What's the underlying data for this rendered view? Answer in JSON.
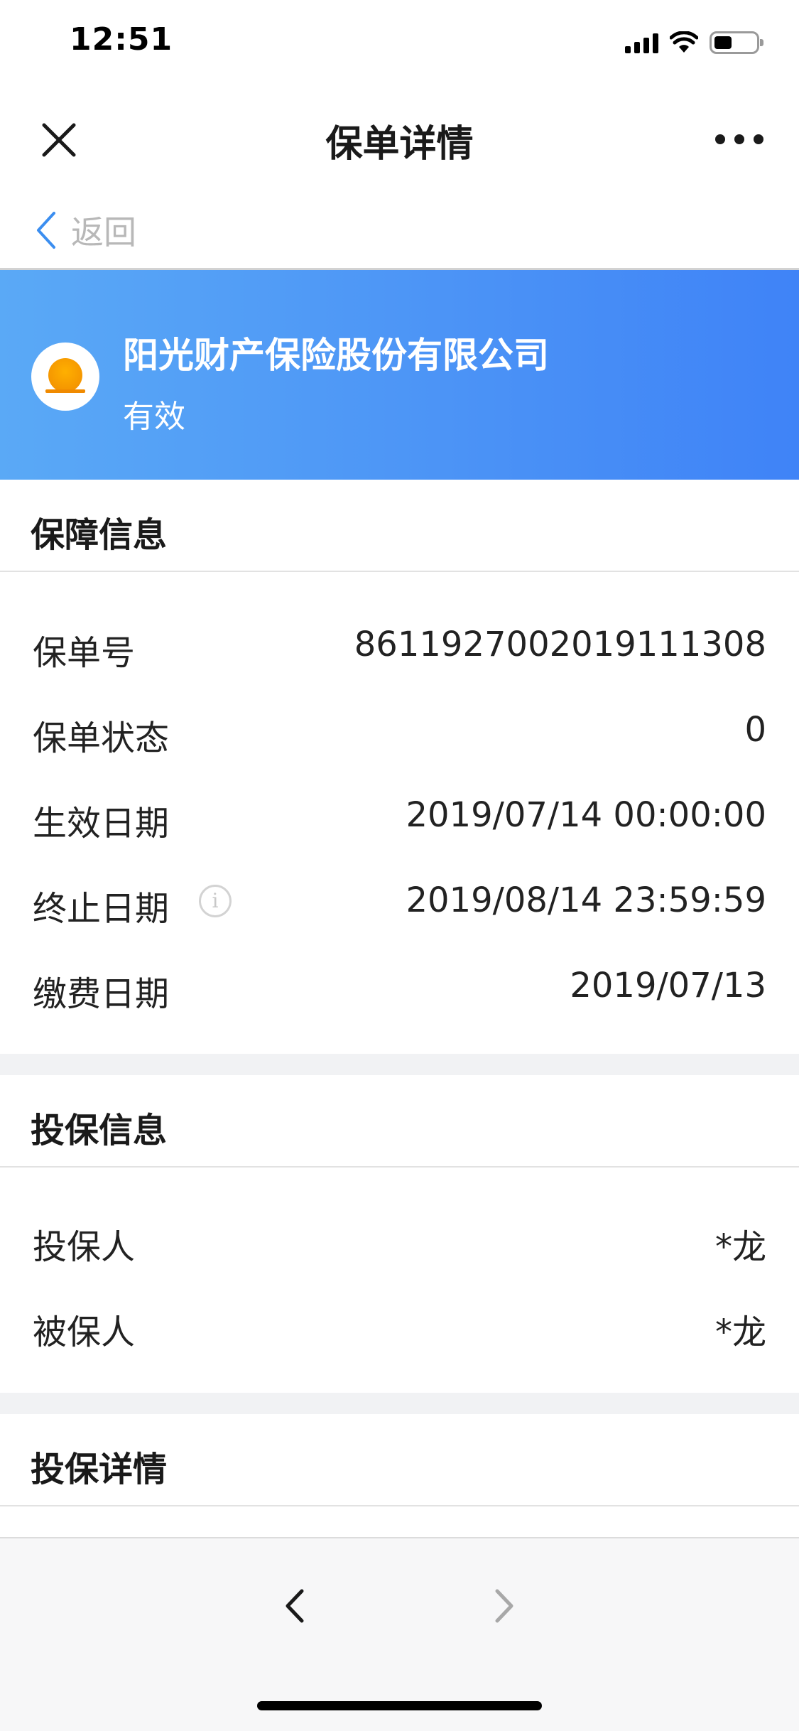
{
  "status_bar": {
    "time": "12:51"
  },
  "nav": {
    "title": "保单详情"
  },
  "back": {
    "label": "返回"
  },
  "banner": {
    "company": "阳光财产保险股份有限公司",
    "status": "有效"
  },
  "sections": {
    "coverage": {
      "title": "保障信息",
      "rows": [
        {
          "label": "保单号",
          "value": "8611927002019111308"
        },
        {
          "label": "保单状态",
          "value": "0"
        },
        {
          "label": "生效日期",
          "value": "2019/07/14 00:00:00"
        },
        {
          "label": "终止日期",
          "value": "2019/08/14 23:59:59"
        },
        {
          "label": "缴费日期",
          "value": "2019/07/13"
        }
      ]
    },
    "insure": {
      "title": "投保信息",
      "rows": [
        {
          "label": "投保人",
          "value": "*龙"
        },
        {
          "label": "被保人",
          "value": "*龙"
        }
      ]
    },
    "detail": {
      "title": "投保详情"
    }
  },
  "colors": {
    "banner_start": "#5aa9f6",
    "banner_end": "#3f83f7",
    "back_chevron": "#3b8ef0",
    "logo_sun": "#f08a00"
  },
  "icons": {
    "close": "close-icon",
    "more": "more-dots-icon",
    "back": "chevron-left-icon",
    "info": "info-icon",
    "browser_back": "chevron-left-icon",
    "browser_forward": "chevron-right-icon"
  }
}
